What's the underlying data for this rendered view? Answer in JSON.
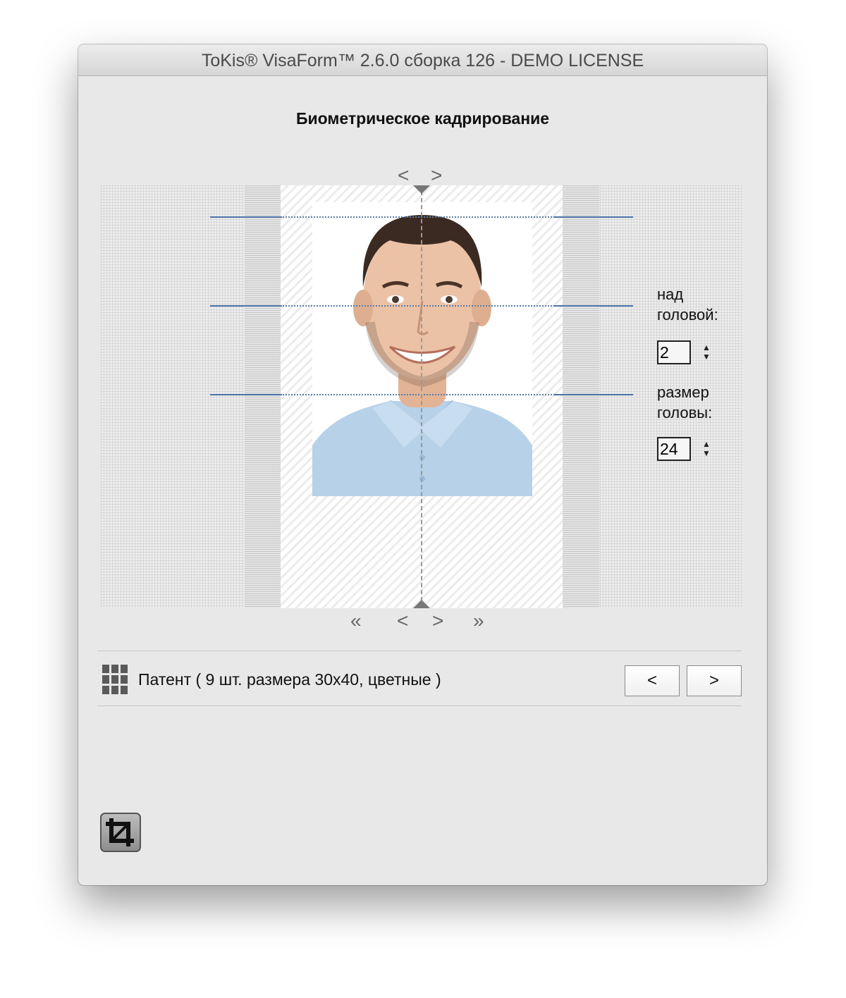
{
  "window": {
    "title": "ToKis® VisaForm™ 2.6.0 сборка 126 - DEMO LICENSE"
  },
  "heading": "Биометрическое кадрирование",
  "nav_top": {
    "left": "<",
    "right": ">"
  },
  "nav_bottom": {
    "first": "«",
    "prev": "<",
    "next": ">",
    "last": "»"
  },
  "fields": {
    "above_head": {
      "label_line1": "над",
      "label_line2": "головой:",
      "value": "2"
    },
    "head_size": {
      "label_line1": "размер",
      "label_line2": "головы:",
      "value": "24"
    }
  },
  "stepper": {
    "up": "▲",
    "down": "▼"
  },
  "format_label": "Патент ( 9 шт. размера 30x40, цветные )",
  "buttons": {
    "prev": "<",
    "next": ">"
  },
  "icons": {
    "grid": "grid-icon",
    "crop": "crop-icon",
    "photo": "person-photo"
  },
  "colors": {
    "guide_line": "#4d72a8",
    "window_bg": "#e8e8e8",
    "shirt": "#b7d1e8"
  }
}
